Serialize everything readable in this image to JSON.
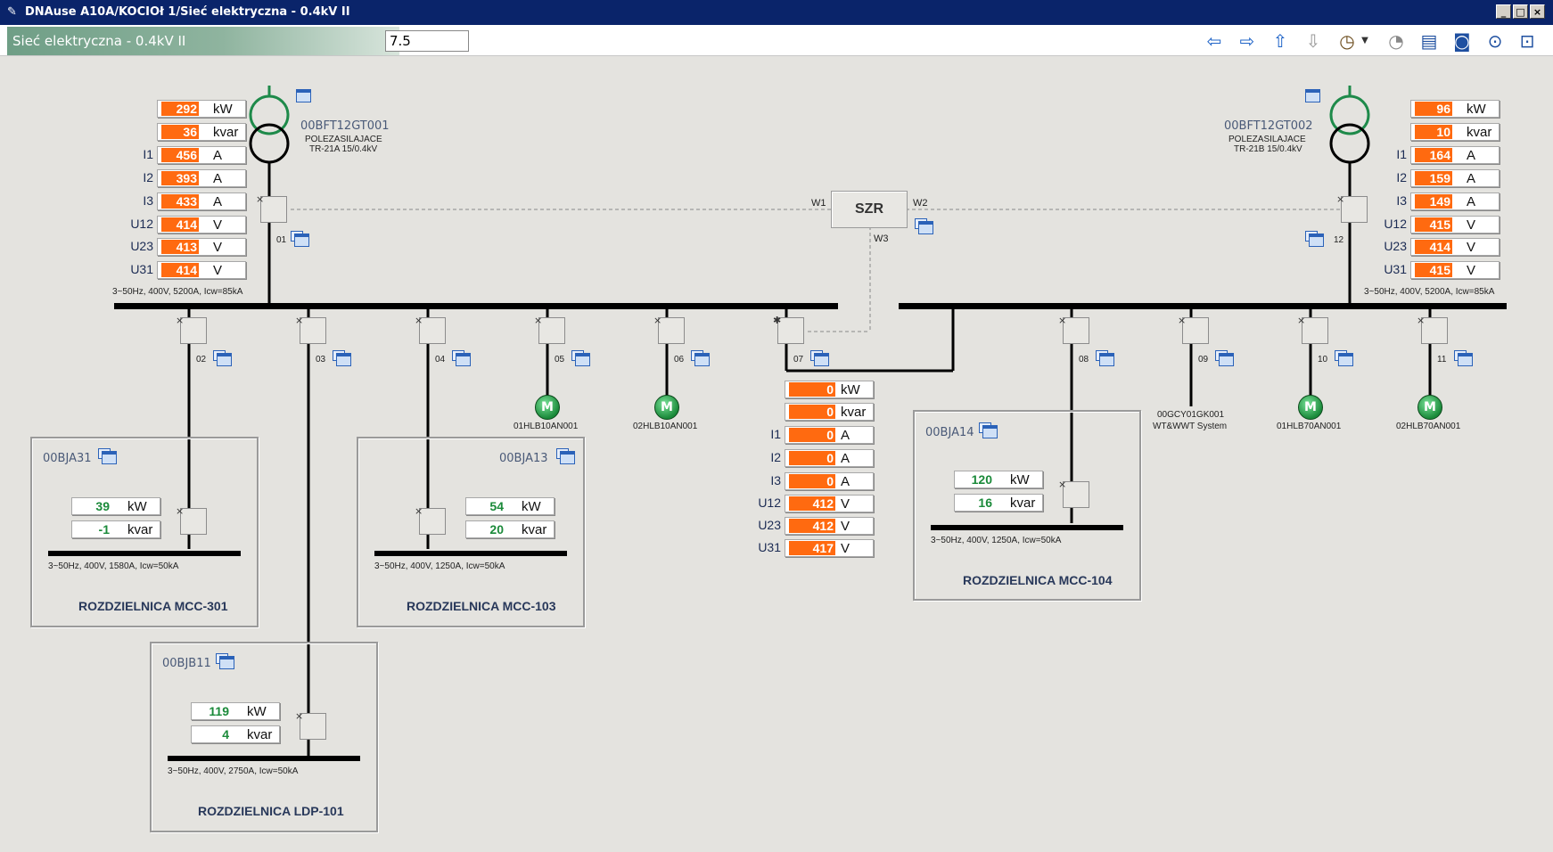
{
  "window": {
    "title": "DNAuse A10A/KOCIOł 1/Sieć elektryczna - 0.4kV II"
  },
  "page": {
    "title": "Sieć elektryczna - 0.4kV II",
    "zoom_value": "7.5"
  },
  "toolbar": {
    "icons": [
      "arrow-left-icon",
      "arrow-right-icon",
      "arrow-up-icon",
      "arrow-down-icon",
      "history-clock-icon",
      "dropdown-icon",
      "refresh-gauge-icon",
      "print-icon",
      "camera-icon",
      "zoom-settings-icon",
      "zoom-fit-icon"
    ]
  },
  "units": {
    "kw": "kW",
    "kvar": "kvar",
    "a": "A",
    "v": "V"
  },
  "labels": {
    "i1": "I1",
    "i2": "I2",
    "i3": "I3",
    "u12": "U12",
    "u23": "U23",
    "u31": "U31"
  },
  "transformers": {
    "left": {
      "code": "00BFT12GT001",
      "desc1": "POLEZASILAJACE",
      "desc2": "TR-21A 15/0.4kV",
      "kw": "292",
      "kvar": "36",
      "i1": "456",
      "i2": "393",
      "i3": "433",
      "u12": "414",
      "u23": "413",
      "u31": "414"
    },
    "right": {
      "code": "00BFT12GT002",
      "desc1": "POLEZASILAJACE",
      "desc2": "TR-21B 15/0.4kV",
      "kw": "96",
      "kvar": "10",
      "i1": "164",
      "i2": "159",
      "i3": "149",
      "u12": "415",
      "u23": "414",
      "u31": "415"
    }
  },
  "busbars": {
    "left_rating": "3~50Hz, 400V, 5200A, Icw=85kA",
    "right_rating": "3~50Hz, 400V, 5200A, Icw=85kA"
  },
  "szr": {
    "label": "SZR",
    "w1": "W1",
    "w2": "W2",
    "w3": "W3"
  },
  "feeders": {
    "f01": "01",
    "f02": "02",
    "f03": "03",
    "f04": "04",
    "f05": "05",
    "f06": "06",
    "f07": "07",
    "f08": "08",
    "f09": "09",
    "f10": "10",
    "f11": "11",
    "f12": "12"
  },
  "motors": {
    "m05": {
      "symbol": "M",
      "code": "01HLB10AN001"
    },
    "m06": {
      "symbol": "M",
      "code": "02HLB10AN001"
    },
    "m10": {
      "symbol": "M",
      "code": "01HLB70AN001"
    },
    "m11": {
      "symbol": "M",
      "code": "02HLB70AN001"
    },
    "f09": {
      "code": "00GCY01GK001",
      "desc": "WT&WWT System"
    }
  },
  "tie07": {
    "kw": "0",
    "kvar": "0",
    "i1": "0",
    "i2": "0",
    "i3": "0",
    "u12": "412",
    "u23": "412",
    "u31": "417"
  },
  "boards": {
    "mcc301": {
      "code": "00BJA31",
      "kw": "39",
      "kvar": "-1",
      "rating": "3~50Hz, 400V, 1580A, Icw=50kA",
      "name": "ROZDZIELNICA MCC-301"
    },
    "mcc103": {
      "code": "00BJA13",
      "kw": "54",
      "kvar": "20",
      "rating": "3~50Hz, 400V, 1250A, Icw=50kA",
      "name": "ROZDZIELNICA MCC-103"
    },
    "mcc104": {
      "code": "00BJA14",
      "kw": "120",
      "kvar": "16",
      "rating": "3~50Hz, 400V, 1250A, Icw=50kA",
      "name": "ROZDZIELNICA MCC-104"
    },
    "ldp101": {
      "code": "00BJB11",
      "kw": "119",
      "kvar": "4",
      "rating": "3~50Hz, 400V, 2750A, Icw=50kA",
      "name": "ROZDZIELNICA LDP-101"
    }
  },
  "colors": {
    "value_bg": "#ff6a10",
    "value_green": "#1b8a3a",
    "titlebar": "#0a246a",
    "transformer_green": "#1e8a4a"
  }
}
